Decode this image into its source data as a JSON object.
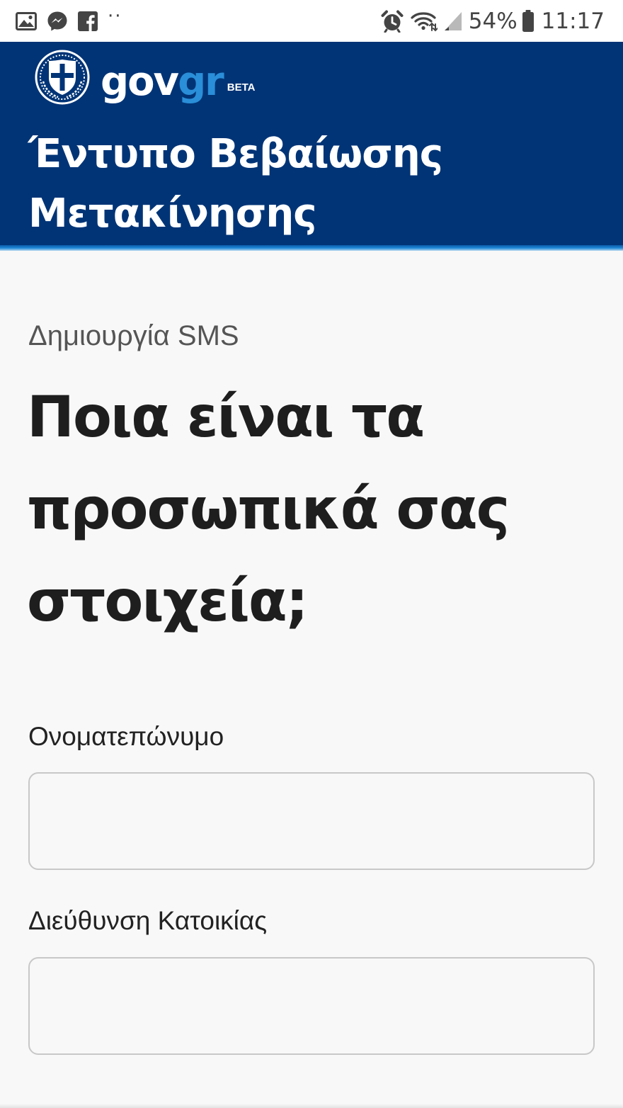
{
  "status_bar": {
    "left_icons": [
      "gallery-icon",
      "messenger-icon",
      "facebook-icon"
    ],
    "overflow": "··",
    "right_icons": [
      "alarm-icon",
      "wifi-icon",
      "signal-icon",
      "battery-icon"
    ],
    "battery": "54%",
    "time": "11:17"
  },
  "header": {
    "logo_gov": "gov",
    "logo_gr": "gr",
    "logo_beta": "BETA",
    "title_line1": "Έντυπο Βεβαίωσης",
    "title_line2": "Μετακίνησης",
    "background_color": "#003476",
    "accent_color": "#2a8ed8"
  },
  "main": {
    "caption": "Δημιουργία SMS",
    "question_line1": "Ποια είναι τα",
    "question_line2": "προσωπικά σας",
    "question_line3": "στοιχεία;",
    "fields": [
      {
        "label": "Ονοματεπώνυμο",
        "value": "",
        "placeholder": ""
      },
      {
        "label": "Διεύθυνση Κατοικίας",
        "value": "",
        "placeholder": ""
      }
    ]
  }
}
